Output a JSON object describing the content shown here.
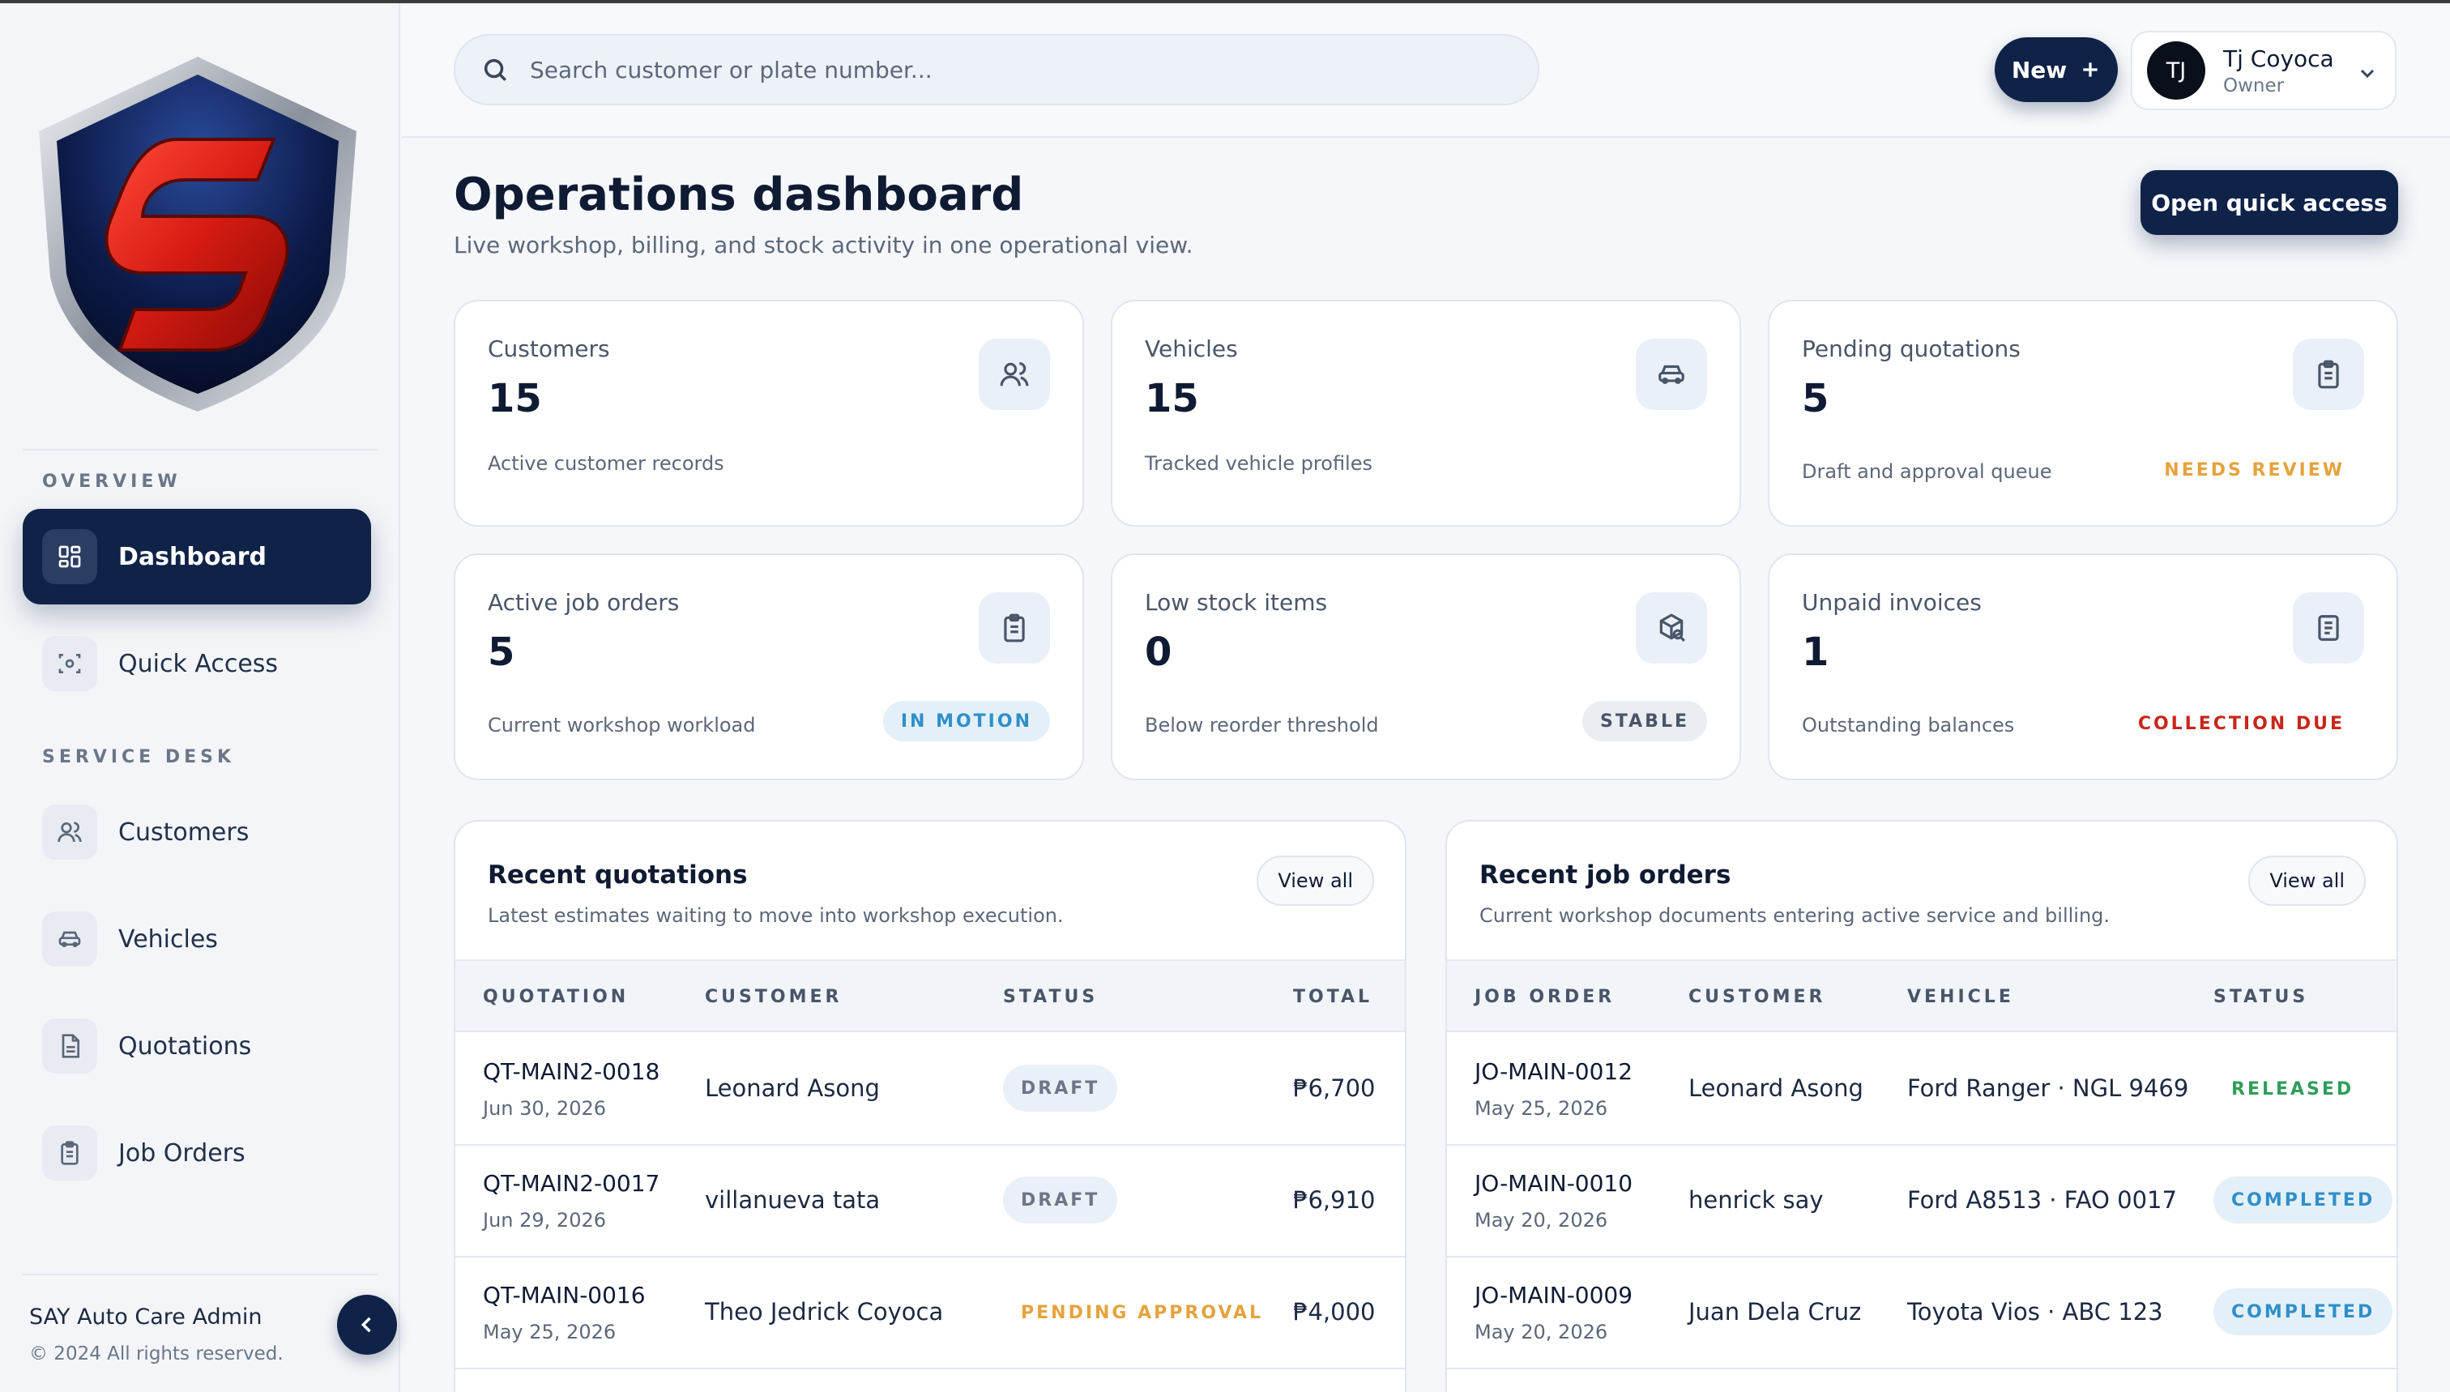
{
  "app": {
    "brand_name": "SAY Auto Care Admin",
    "copyright": "© 2024 All rights reserved."
  },
  "sidebar": {
    "sections": [
      {
        "label": "OVERVIEW"
      },
      {
        "label": "SERVICE DESK"
      }
    ],
    "items": [
      {
        "label": "Dashboard",
        "icon": "dashboard-icon",
        "active": true
      },
      {
        "label": "Quick Access",
        "icon": "scan-icon"
      },
      {
        "label": "Customers",
        "icon": "users-icon"
      },
      {
        "label": "Vehicles",
        "icon": "car-icon"
      },
      {
        "label": "Quotations",
        "icon": "document-icon"
      },
      {
        "label": "Job Orders",
        "icon": "clipboard-icon"
      }
    ]
  },
  "header": {
    "search_placeholder": "Search customer or plate number...",
    "new_label": "New",
    "user": {
      "initials": "TJ",
      "name": "Tj Coyoca",
      "role": "Owner"
    }
  },
  "page": {
    "title": "Operations dashboard",
    "subtitle": "Live workshop, billing, and stock activity in one operational view.",
    "quick_access_label": "Open quick access"
  },
  "stats": [
    {
      "label": "Customers",
      "value": "15",
      "description": "Active customer records",
      "icon": "users-icon",
      "badge": ""
    },
    {
      "label": "Vehicles",
      "value": "15",
      "description": "Tracked vehicle profiles",
      "icon": "car-icon",
      "badge": ""
    },
    {
      "label": "Pending quotations",
      "value": "5",
      "description": "Draft and approval queue",
      "icon": "clipboard-icon",
      "badge": "NEEDS REVIEW",
      "badge_color": "#e6a23c"
    },
    {
      "label": "Active job orders",
      "value": "5",
      "description": "Current workshop workload",
      "icon": "clipboard-icon",
      "badge": "IN MOTION",
      "badge_color": "#2f8fc9"
    },
    {
      "label": "Low stock items",
      "value": "0",
      "description": "Below reorder threshold",
      "icon": "package-search-icon",
      "badge": "STABLE",
      "badge_color": "#4a5568"
    },
    {
      "label": "Unpaid invoices",
      "value": "1",
      "description": "Outstanding balances",
      "icon": "invoice-icon",
      "badge": "COLLECTION DUE",
      "badge_color": "#c8261b"
    }
  ],
  "recent_quotations": {
    "title": "Recent quotations",
    "subtitle": "Latest estimates waiting to move into workshop execution.",
    "view_all_label": "View all",
    "columns": [
      "QUOTATION",
      "CUSTOMER",
      "STATUS",
      "TOTAL"
    ],
    "rows": [
      {
        "id": "QT-MAIN2-0018",
        "date": "Jun 30, 2026",
        "customer": "Leonard Asong",
        "status": "DRAFT",
        "total": "₱6,700"
      },
      {
        "id": "QT-MAIN2-0017",
        "date": "Jun 29, 2026",
        "customer": "villanueva tata",
        "status": "DRAFT",
        "total": "₱6,910"
      },
      {
        "id": "QT-MAIN-0016",
        "date": "May 25, 2026",
        "customer": "Theo Jedrick Coyoca",
        "status": "PENDING APPROVAL",
        "total": "₱4,000"
      }
    ]
  },
  "recent_job_orders": {
    "title": "Recent job orders",
    "subtitle": "Current workshop documents entering active service and billing.",
    "view_all_label": "View all",
    "columns": [
      "JOB ORDER",
      "CUSTOMER",
      "VEHICLE",
      "STATUS"
    ],
    "rows": [
      {
        "id": "JO-MAIN-0012",
        "date": "May 25, 2026",
        "customer": "Leonard Asong",
        "vehicle": "Ford Ranger · NGL 9469",
        "status": "RELEASED"
      },
      {
        "id": "JO-MAIN-0010",
        "date": "May 20, 2026",
        "customer": "henrick say",
        "vehicle": "Ford A8513 · FAO 0017",
        "status": "COMPLETED"
      },
      {
        "id": "JO-MAIN-0009",
        "date": "May 20, 2026",
        "customer": "Juan Dela Cruz",
        "vehicle": "Toyota Vios · ABC 123",
        "status": "COMPLETED"
      }
    ]
  },
  "colors": {
    "primary": "#0f2248",
    "released": "#2f9e5a",
    "completed": "#2f8fc9",
    "pending": "#e6a23c"
  }
}
